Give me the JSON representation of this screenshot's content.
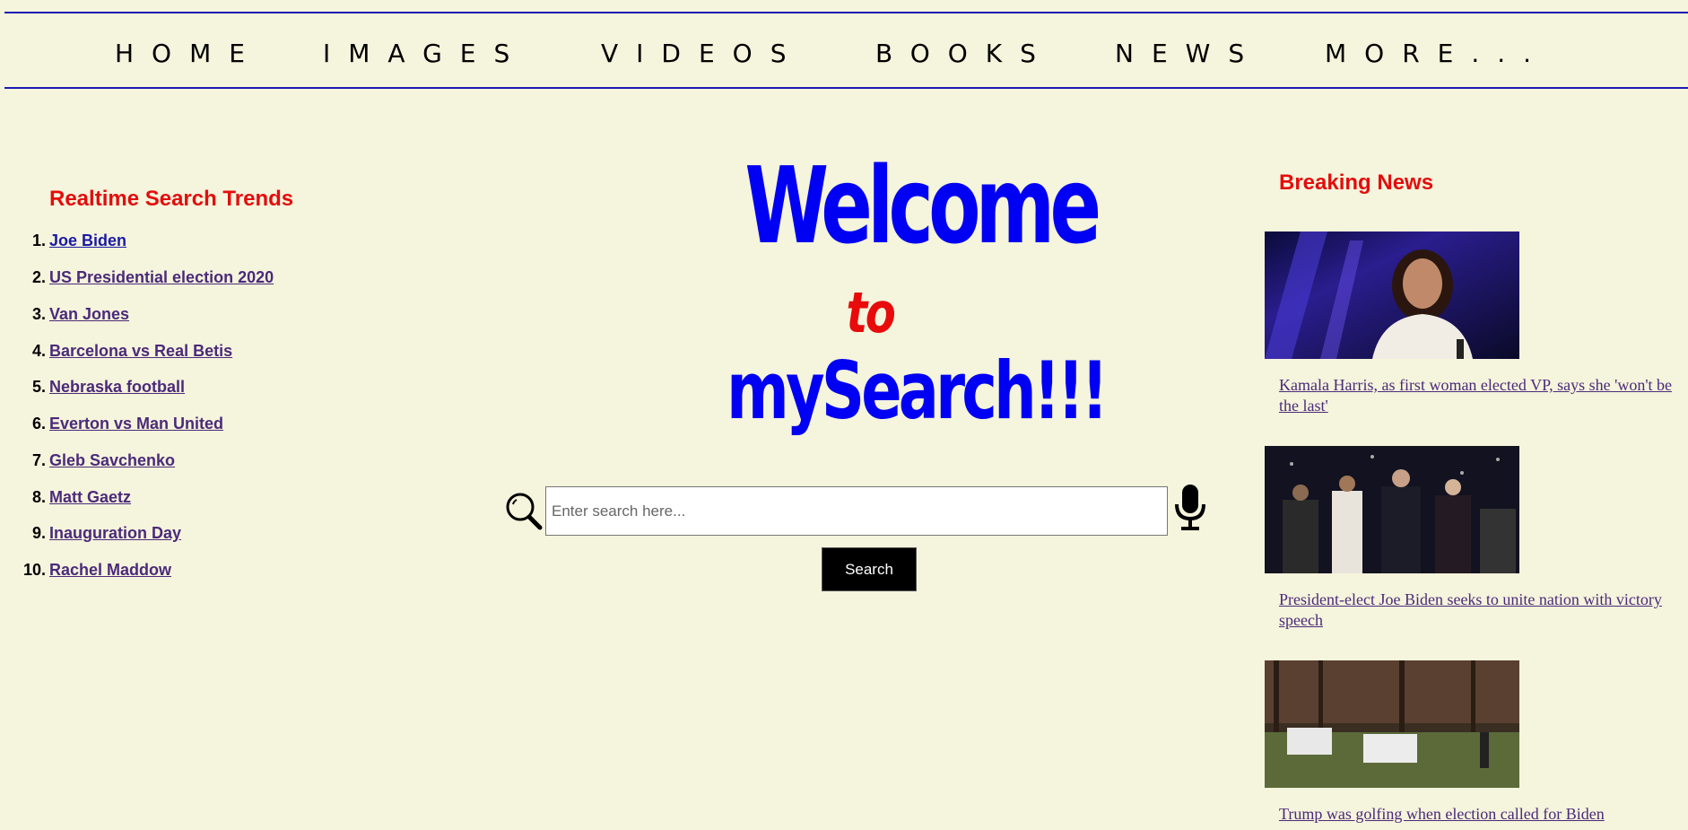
{
  "nav": {
    "items": [
      "HOME",
      "IMAGES",
      "VIDEOS",
      "BOOKS",
      "NEWS",
      "MORE..."
    ]
  },
  "trends": {
    "title": "Realtime Search Trends",
    "items": [
      {
        "num": "1.",
        "label": "Joe Biden"
      },
      {
        "num": "2.",
        "label": "US Presidential election 2020"
      },
      {
        "num": "3.",
        "label": "Van Jones"
      },
      {
        "num": "4.",
        "label": "Barcelona vs Real Betis"
      },
      {
        "num": "5.",
        "label": "Nebraska football"
      },
      {
        "num": "6.",
        "label": "Everton vs Man United"
      },
      {
        "num": "7.",
        "label": "Gleb Savchenko"
      },
      {
        "num": "8.",
        "label": "Matt Gaetz"
      },
      {
        "num": "9.",
        "label": "Inauguration Day"
      },
      {
        "num": "10.",
        "label": "Rachel Maddow"
      }
    ]
  },
  "hero": {
    "line1": "Welcome",
    "line2": "to",
    "line3": "mySearch!!!"
  },
  "search": {
    "placeholder": "Enter search here...",
    "value": "",
    "button_label": "Search"
  },
  "news": {
    "title": "Breaking News",
    "items": [
      {
        "headline": "Kamala Harris, as first woman elected VP, says she 'won't be the last'"
      },
      {
        "headline": "President-elect Joe Biden seeks to unite nation with victory speech"
      },
      {
        "headline": "Trump was golfing when election called for Biden"
      }
    ]
  },
  "colors": {
    "background": "#f5f4dc",
    "heading_red": "#e30d0d",
    "hero_blue": "#0000f2",
    "nav_border": "#1a1ab3",
    "visited_link": "#4b2a7a"
  }
}
